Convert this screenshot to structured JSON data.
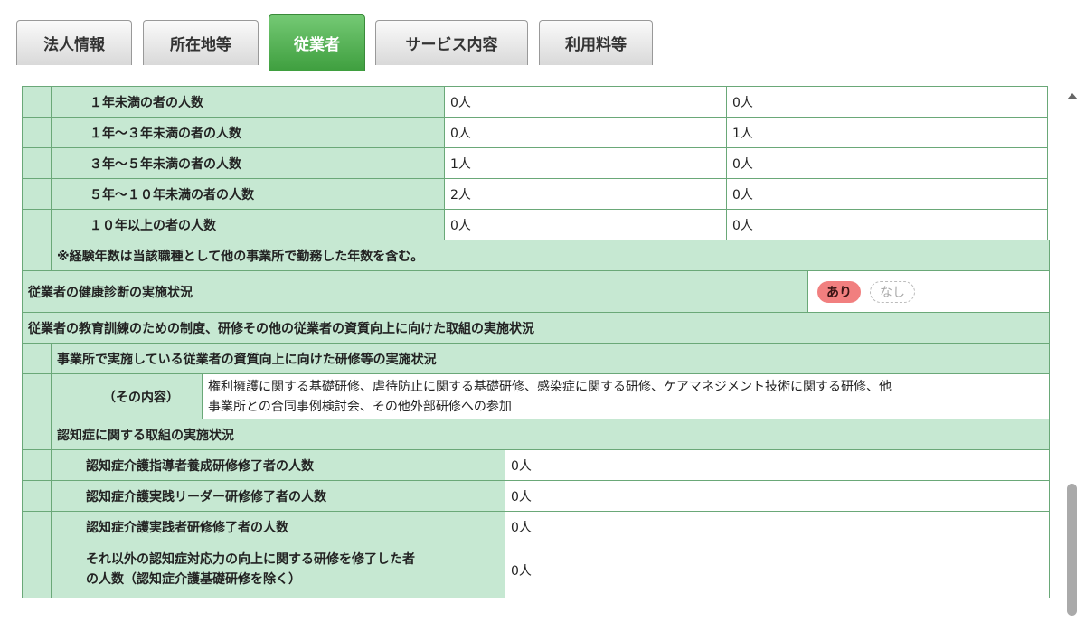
{
  "tabs": [
    {
      "label": "法人情報",
      "active": false
    },
    {
      "label": "所在地等",
      "active": false
    },
    {
      "label": "従業者",
      "active": true
    },
    {
      "label": "サービス内容",
      "active": false
    },
    {
      "label": "利用料等",
      "active": false
    }
  ],
  "experience": {
    "rows": [
      {
        "label": "１年未満の者の人数",
        "v1": "0人",
        "v2": "0人"
      },
      {
        "label": "１年～３年未満の者の人数",
        "v1": "0人",
        "v2": "1人"
      },
      {
        "label": "３年～５年未満の者の人数",
        "v1": "1人",
        "v2": "0人"
      },
      {
        "label": "５年～１０年未満の者の人数",
        "v1": "2人",
        "v2": "0人"
      },
      {
        "label": "１０年以上の者の人数",
        "v1": "0人",
        "v2": "0人"
      }
    ],
    "note": "※経験年数は当該職種として他の事業所で勤務した年数を含む。"
  },
  "health_check": {
    "label": "従業者の健康診断の実施状況",
    "yes": "あり",
    "no": "なし",
    "selected": "あり"
  },
  "training": {
    "section_title": "従業者の教育訓練のための制度、研修その他の従業者の資質向上に向けた取組の実施状況",
    "sub_title": "事業所で実施している従業者の資質向上に向けた研修等の実施状況",
    "content_label": "（その内容）",
    "content_line1": "権利擁護に関する基礎研修、虐待防止に関する基礎研修、感染症に関する研修、ケアマネジメント技術に関する研修、他",
    "content_line2": "事業所との合同事例検討会、その他外部研修への参加"
  },
  "dementia": {
    "title": "認知症に関する取組の実施状況",
    "rows": [
      {
        "label": "認知症介護指導者養成研修修了者の人数",
        "value": "0人"
      },
      {
        "label": "認知症介護実践リーダー研修修了者の人数",
        "value": "0人"
      },
      {
        "label": "認知症介護実践者研修修了者の人数",
        "value": "0人"
      }
    ],
    "last_label_line1": "それ以外の認知症対応力の向上に関する研修を修了した者",
    "last_label_line2": "の人数（認知症介護基礎研修を除く）",
    "last_value": "0人"
  },
  "colors": {
    "header_bg": "#c6e8d2",
    "border": "#6aa878",
    "active_tab": "#4caf50",
    "pill_on": "#f17f7f"
  }
}
